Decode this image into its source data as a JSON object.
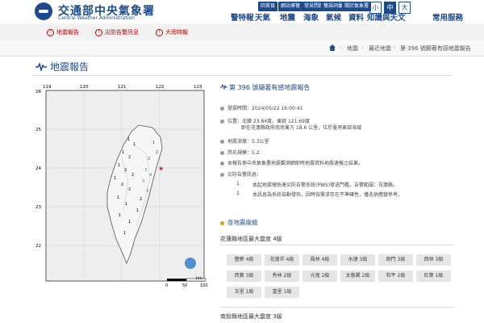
{
  "header": {
    "org_cn": "交通部中央氣象署",
    "org_en": "Central Weather Administration",
    "top_links": [
      "回首頁",
      "網站導覽",
      "常見問題",
      "雙語詞彙",
      "關於氣象署"
    ],
    "size_buttons": [
      "小",
      "中",
      "大"
    ],
    "main_nav": [
      "警特報",
      "天氣",
      "地震",
      "海象",
      "氣候",
      "資料",
      "知識與天文",
      "常用服務"
    ]
  },
  "alerts": [
    "地震報告",
    "災防告警訊息",
    "大雨特報"
  ],
  "breadcrumb": [
    "地震",
    "最近地震",
    "第 396 號顯著有感地震報告"
  ],
  "page_title": "地震報告",
  "map": {
    "lon_ticks": [
      "119",
      "120",
      "121",
      "122",
      "123"
    ],
    "lat_ticks": [
      "26",
      "25",
      "24",
      "23",
      "22"
    ],
    "scale_ticks": [
      "0",
      "50",
      "100"
    ],
    "scale_unit": "km"
  },
  "report": {
    "title": "第 396 號顯著有感地震報告",
    "time": "發震時間：2024/05/22 16:00:41",
    "location_1": "位置：北緯 23.84度，東經 121.69度",
    "location_2": "即在花蓮縣政府南南東方 18.6 公里，位於臺灣東部海域",
    "depth": "地震深度：5.3公里",
    "magnitude": "芮氏規模：5.2",
    "note": "本報告係中央氣象署地震觀測網即時地震資料地震速報之結果。",
    "warning_label": "災防告警訊息：",
    "warning_1_num": "1.",
    "warning_1": "本起地震預估達災防告警系統(PWS)發送門檻，告警範圍：花蓮縣。",
    "warning_2_num": "2.",
    "warning_2": "本訊息為系統自動發布，因時效需求存在不準確性，僅迭供應變參考。"
  },
  "intensity_section": {
    "title": "各地震度級",
    "hualien_title": "花蓮縣地區最大震度 4級",
    "hualien_stations": [
      "鹽寮 4級",
      "花蓮市 4級",
      "鳳林 4級",
      "水璉 3級",
      "銅門 3級",
      "西林 3級",
      "西寶 3級",
      "秀林 2級",
      "光復 2級",
      "太魯閣 2級",
      "和平 2級",
      "紅葉 1級",
      "玉里 1級",
      "富里 1級"
    ],
    "nantou_title": "南投縣地區最大震度 3級"
  },
  "colors": {
    "brand": "#1c4a8d",
    "alert": "#b30000",
    "section_icon": "#d9a400"
  }
}
